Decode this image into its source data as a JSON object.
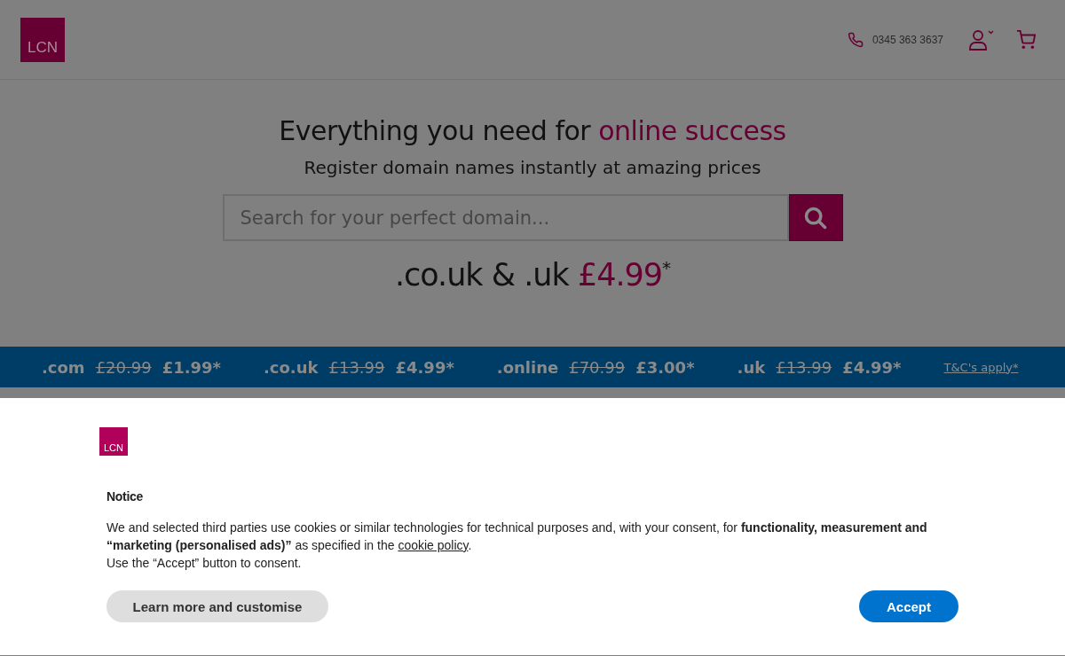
{
  "header": {
    "logo": "LCN",
    "phone": "0345 363 3637"
  },
  "hero": {
    "title": "Everything you need for ",
    "title_highlight": "online success",
    "subtitle": "Register domain names instantly at amazing prices",
    "search": {
      "placeholder": "Search for your perfect domain..."
    },
    "offer": ".co.uk & .uk ",
    "offer_price": "£4.99",
    "offer_mark": "*"
  },
  "promos": [
    {
      "tld": ".com",
      "old_price": "£20.99",
      "price": "£1.99*"
    },
    {
      "tld": ".co.uk",
      "old_price": "£13.99",
      "price": "£4.99*"
    },
    {
      "tld": ".online",
      "old_price": "£70.99",
      "price": "£3.00*"
    },
    {
      "tld": ".uk",
      "old_price": "£13.99",
      "price": "£4.99*"
    }
  ],
  "terms_link": "T&C's apply*",
  "consent": {
    "logo": "LCN",
    "title": "Notice",
    "text": "We and selected third parties use cookies or similar technologies for technical purposes and, with your consent, for **functionality, measurement and “marketing (personalised ads)”** as specified in the ",
    "link": "cookie policy",
    "text_end": ".",
    "note": "Use the “Accept” button to consent.",
    "buttons": [
      {
        "label": "Learn more and customise",
        "kind": "secondary"
      },
      {
        "label": "Accept",
        "kind": "primary"
      }
    ]
  }
}
